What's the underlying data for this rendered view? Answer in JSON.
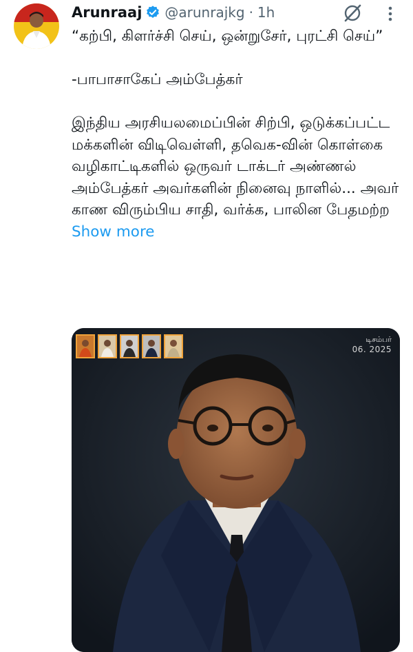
{
  "tweet": {
    "author": {
      "display_name": "Arunraaj",
      "handle": "@arunrajkg",
      "verified": true
    },
    "separator": "·",
    "time": "1h",
    "text_lines": [
      "“கற்பி, கிளர்ச்சி செய், ஒன்றுசேர், புரட்சி செய்”",
      "",
      "-பாபாசாகேப் அம்பேத்கர்",
      "",
      "இந்திய அரசியலமைப்பின் சிற்பி, ஒடுக்கப்பட்ட மக்களின் விடிவெள்ளி, தவெக-வின் கொள்கை வழிகாட்டிகளில் ஒருவர் டாக்டர் அண்ணல் அம்பேத்கர் அவர்களின் நினைவு நாளில்... அவர் காண விரும்பிய சாதி, வர்க்க, பாலின பேதமற்ற"
    ],
    "show_more_label": "Show more"
  },
  "media": {
    "date_month": "டிசம்பர்",
    "date_day": "06. 2025"
  },
  "colors": {
    "accent": "#1d9bf0",
    "text": "#0f1419",
    "secondary_text": "#536471",
    "thumb_border": "#f0a33a"
  },
  "icons": {
    "verified": "verified-badge-icon",
    "grok": "grok-icon",
    "more": "more-vertical-icon"
  }
}
